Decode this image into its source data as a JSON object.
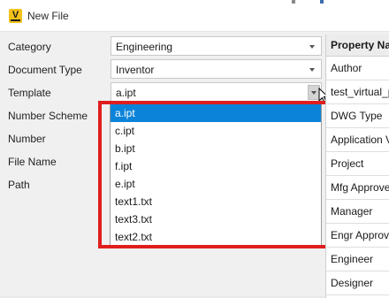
{
  "window": {
    "title": "New File",
    "icon_letter": "V"
  },
  "form": {
    "labels": [
      "Category",
      "Document Type",
      "Template",
      "Number Scheme",
      "Number",
      "File Name",
      "Path"
    ],
    "category_value": "Engineering",
    "doc_type_value": "Inventor",
    "template_value": "a.ipt"
  },
  "template_options": [
    "a.ipt",
    "c.ipt",
    "b.ipt",
    "f.ipt",
    "e.ipt",
    "text1.txt",
    "text3.txt",
    "text2.txt"
  ],
  "selected_option": "a.ipt",
  "properties": {
    "header": "Property Na",
    "rows": [
      "Author",
      "test_virtual_p",
      "DWG Type",
      "Application V",
      "Project",
      "Mfg Approve",
      "Manager",
      "Engr Approve",
      "Engineer",
      "Designer"
    ]
  },
  "colors": {
    "selection": "#0b83d9",
    "highlight_box": "#e01e1e",
    "icon": "#f2c21b"
  }
}
